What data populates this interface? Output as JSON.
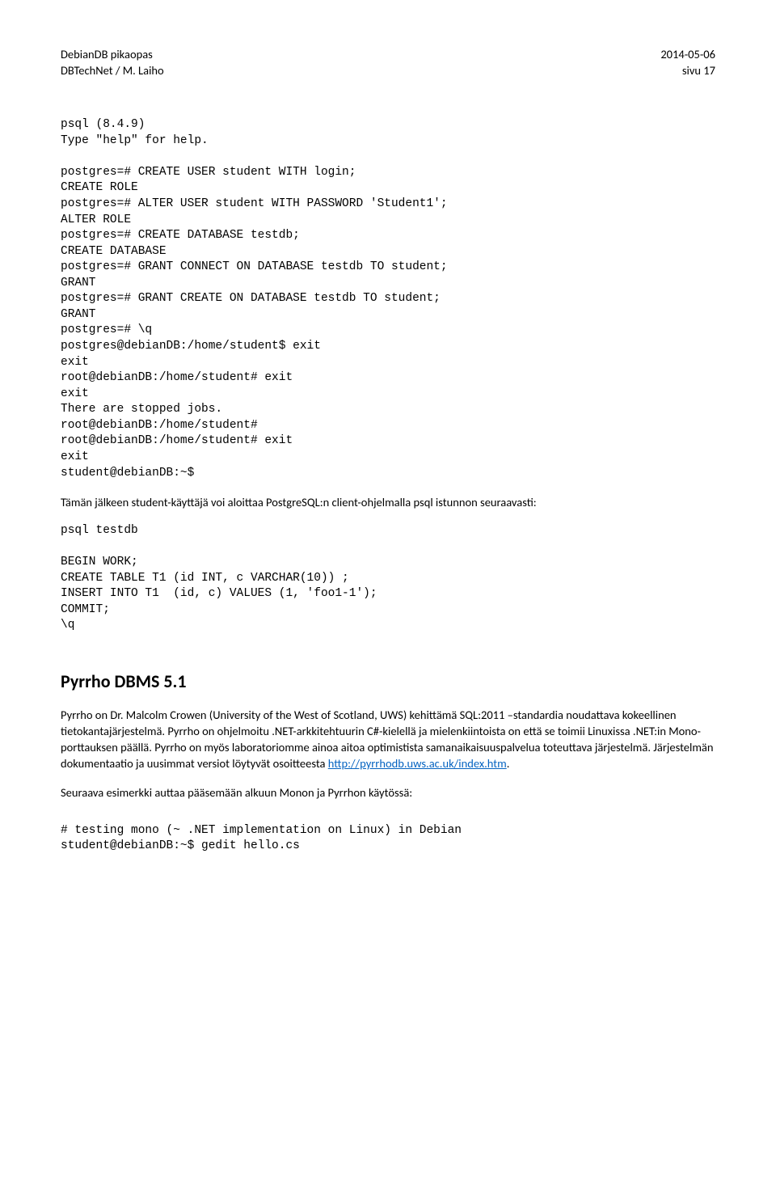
{
  "header": {
    "left1": "DebianDB pikaopas",
    "right1": "2014-05-06",
    "left2": "DBTechNet / M. Laiho",
    "right2": "sivu 17"
  },
  "code1": "psql (8.4.9)\nType \"help\" for help.\n\npostgres=# CREATE USER student WITH login;\nCREATE ROLE\npostgres=# ALTER USER student WITH PASSWORD 'Student1';\nALTER ROLE\npostgres=# CREATE DATABASE testdb;\nCREATE DATABASE\npostgres=# GRANT CONNECT ON DATABASE testdb TO student;\nGRANT\npostgres=# GRANT CREATE ON DATABASE testdb TO student;\nGRANT\npostgres=# \\q\npostgres@debianDB:/home/student$ exit\nexit\nroot@debianDB:/home/student# exit\nexit\nThere are stopped jobs.\nroot@debianDB:/home/student#\nroot@debianDB:/home/student# exit\nexit\nstudent@debianDB:~$",
  "para1": "Tämän jälkeen student-käyttäjä voi aloittaa PostgreSQL:n client-ohjelmalla psql istunnon seuraavasti:",
  "code2": "psql testdb\n\nBEGIN WORK;\nCREATE TABLE T1 (id INT, c VARCHAR(10)) ;\nINSERT INTO T1  (id, c) VALUES (1, 'foo1-1');\nCOMMIT;\n\\q",
  "section": {
    "title": "Pyrrho DBMS 5.1",
    "p2_pre": "Pyrrho on Dr. Malcolm Crowen (University of the West of Scotland, UWS) kehittämä SQL:2011 –standardia noudattava kokeellinen tietokantajärjestelmä.  Pyrrho on ohjelmoitu .NET-arkkitehtuurin C#-kielellä ja mielenkiintoista on että se toimii Linuxissa .NET:in Mono-porttauksen päällä.  Pyrrho on myös laboratoriomme ainoa aitoa optimistista samanaikaisuuspalvelua toteuttava järjestelmä. Järjestelmän dokumentaatio ja uusimmat versiot löytyvät osoitteesta ",
    "link_text": "http://pyrrhodb.uws.ac.uk/index.htm",
    "p2_post": ".",
    "p3": "Seuraava esimerkki auttaa pääsemään alkuun Monon ja Pyrrhon käytössä:"
  },
  "code3": "# testing mono (~ .NET implementation on Linux) in Debian\nstudent@debianDB:~$ gedit hello.cs"
}
